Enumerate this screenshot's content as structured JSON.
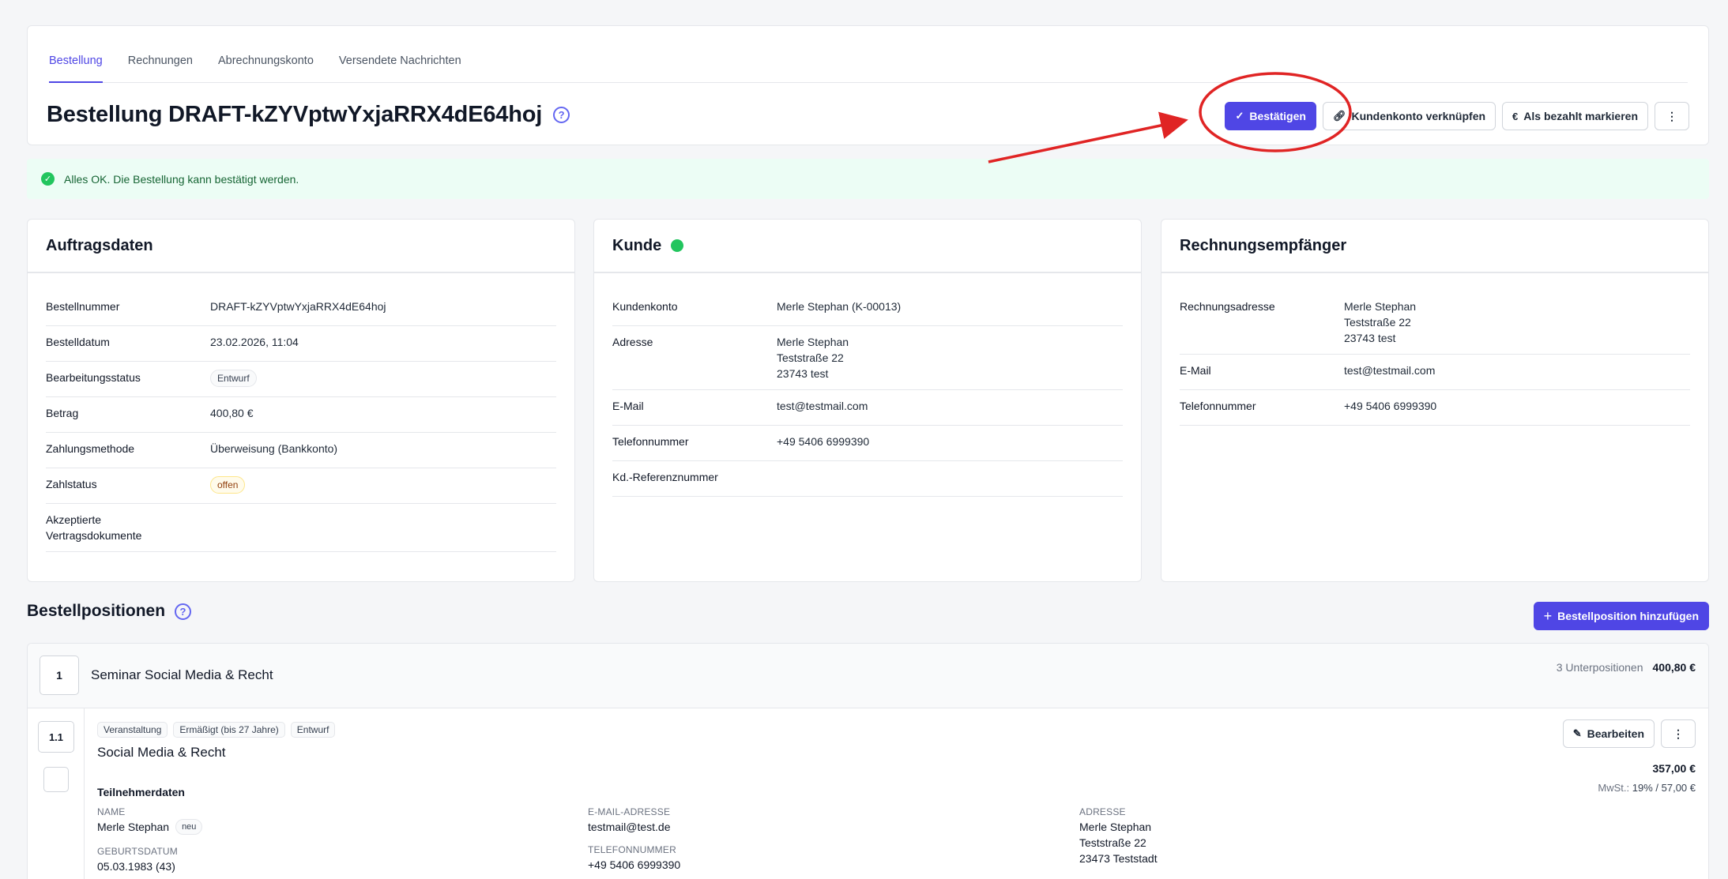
{
  "tabs": [
    {
      "label": "Bestellung",
      "active": true
    },
    {
      "label": "Rechnungen"
    },
    {
      "label": "Abrechnungskonto"
    },
    {
      "label": "Versendete Nachrichten"
    }
  ],
  "page": {
    "title": "Bestellung DRAFT-kZYVptwYxjaRRX4dE64hoj",
    "help_icon": "?"
  },
  "actions": {
    "confirm": "Bestätigen",
    "link_account": "Kundenkonto verknüpfen",
    "mark_paid": "Als bezahlt markieren",
    "more": "⋮"
  },
  "alert": {
    "text": "Alles OK. Die Bestellung kann bestätigt werden."
  },
  "order": {
    "title": "Auftragsdaten",
    "rows": [
      {
        "label": "Bestellnummer",
        "value": "DRAFT-kZYVptwYxjaRRX4dE64hoj"
      },
      {
        "label": "Bestelldatum",
        "value": "23.02.2026, 11:04"
      },
      {
        "label": "Bearbeitungsstatus",
        "value": "Entwurf"
      },
      {
        "label": "Betrag",
        "value": "400,80 €"
      },
      {
        "label": "Zahlungsmethode",
        "value": "Überweisung (Bankkonto)"
      },
      {
        "label": "Zahlstatus",
        "value": "offen"
      },
      {
        "label_line1": "Akzeptierte",
        "label_line2": "Vertragsdokumente",
        "value": ""
      }
    ]
  },
  "customer": {
    "title": "Kunde",
    "status_color": "#22c55e",
    "rows": [
      {
        "label": "Kundenkonto",
        "value": "Merle Stephan (K-00013)"
      },
      {
        "label": "Adresse",
        "lines": [
          "Merle Stephan",
          "Teststraße 22",
          "23743 test"
        ]
      },
      {
        "label": "E-Mail",
        "value": "test@testmail.com"
      },
      {
        "label": "Telefonnummer",
        "value": "+49 5406 6999390"
      },
      {
        "label": "Kd.-Referenznummer",
        "value": ""
      }
    ]
  },
  "billing": {
    "title": "Rechnungsempfänger",
    "rows": [
      {
        "label": "Rechnungsadresse",
        "lines": [
          "Merle Stephan",
          "Teststraße 22",
          "23743 test"
        ]
      },
      {
        "label": "E-Mail",
        "value": "test@testmail.com"
      },
      {
        "label": "Telefonnummer",
        "value": "+49 5406 6999390"
      }
    ]
  },
  "positions": {
    "title": "Bestellpositionen",
    "add_button": "Bestellposition hinzufügen",
    "item": {
      "number": "1",
      "name": "Seminar Social Media & Recht",
      "sub_count": "3 Unterpositionen",
      "total": "400,80 €",
      "sub": {
        "number": "1.1",
        "tags": [
          "Veranstaltung",
          "Ermäßigt (bis 27 Jahre)",
          "Entwurf"
        ],
        "title": "Social Media & Recht",
        "edit": "Bearbeiten",
        "more": "⋮",
        "price": "357,00 €",
        "tax_label": "MwSt.:",
        "tax_value": "19% / 57,00 €",
        "participants_title": "Teilnehmerdaten",
        "name_label": "NAME",
        "name_value": "Merle Stephan",
        "name_badge": "neu",
        "birth_label": "GEBURTSDATUM",
        "birth_value": "05.03.1983 (43)",
        "email_label": "E-MAIL-ADRESSE",
        "email_value": "testmail@test.de",
        "phone_label": "TELEFONNUMMER",
        "phone_value": "+49 5406 6999390",
        "address_label": "ADRESSE",
        "address_lines": [
          "Merle Stephan",
          "Teststraße 22",
          "23473 Teststadt"
        ]
      }
    }
  },
  "colors": {
    "primary": "#4f46e5",
    "success": "#22c55e",
    "annotation": "#e02424"
  }
}
